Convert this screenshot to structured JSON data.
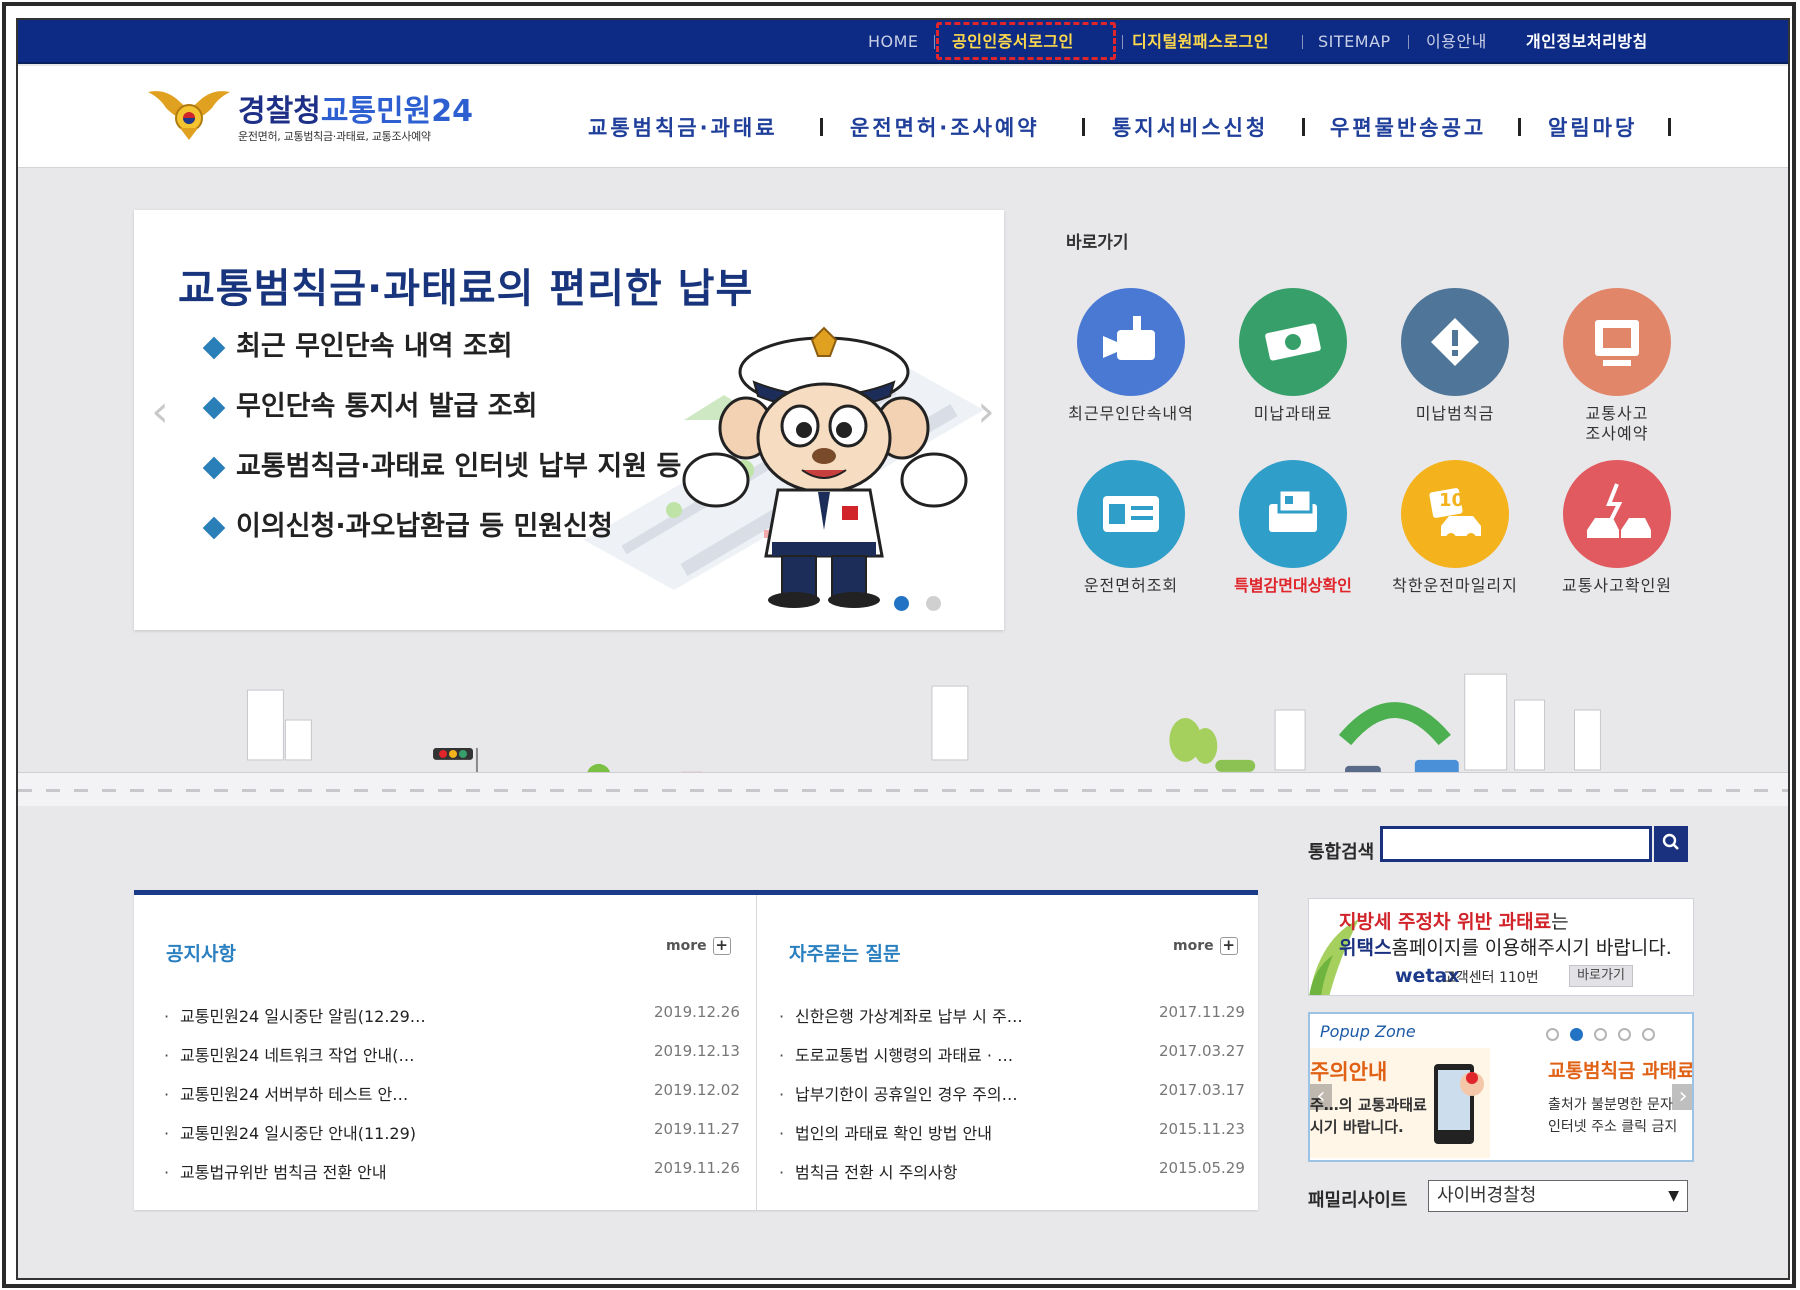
{
  "utility_nav": {
    "home": "HOME",
    "cert_login": "공인인증서로그인",
    "digital_pass_login": "디지털원패스로그인",
    "sitemap": "SITEMAP",
    "usage_guide": "이용안내",
    "privacy_policy": "개인정보처리방침"
  },
  "logo": {
    "org": "경찰청",
    "service": "교통민원24",
    "subtitle": "운전면허, 교통범칙금·과태료, 교통조사예약"
  },
  "main_nav": [
    {
      "label": "교통범칙금·과태료"
    },
    {
      "label": "운전면허·조사예약"
    },
    {
      "label": "통지서비스신청"
    },
    {
      "label": "우편물반송공고"
    },
    {
      "label": "알림마당"
    }
  ],
  "hero": {
    "headline": "교통범칙금·과태료의 편리한 납부",
    "bullets": [
      "최근 무인단속 내역 조회",
      "무인단속 통지서 발급 조회",
      "교통범칙금·과태료 인터넷 납부 지원 등",
      "이의신청·과오납환급 등 민원신청"
    ],
    "prev_arrow": "‹",
    "next_arrow": "›"
  },
  "shortcuts": {
    "title": "바로가기",
    "items": [
      {
        "label": "최근무인단속내역",
        "color": "#4a79d4",
        "icon": "camera-icon"
      },
      {
        "label": "미납과태료",
        "color": "#37a06a",
        "icon": "money-icon"
      },
      {
        "label": "미납범칙금",
        "color": "#4f7598",
        "icon": "warning-icon"
      },
      {
        "label": "교통사고\n조사예약",
        "color": "#e2866a",
        "icon": "monitor-icon"
      },
      {
        "label": "운전면허조회",
        "color": "#2f9ec9",
        "icon": "license-card-icon"
      },
      {
        "label": "특별감면대상확인",
        "color": "#2f9ec9",
        "icon": "document-icon",
        "highlight": true
      },
      {
        "label": "착한운전마일리지",
        "color": "#f4b21c",
        "icon": "mileage-car-icon",
        "badge": "10"
      },
      {
        "label": "교통사고확인원",
        "color": "#e05a5f",
        "icon": "car-crash-icon"
      }
    ]
  },
  "search": {
    "label": "통합검색",
    "placeholder": "",
    "button_icon": "search-icon"
  },
  "notices": {
    "title": "공지사항",
    "more": "more",
    "items": [
      {
        "title": "교통민원24 일시중단 알림(12.29…",
        "date": "2019.12.26"
      },
      {
        "title": "교통민원24 네트워크 작업 안내(…",
        "date": "2019.12.13"
      },
      {
        "title": "교통민원24 서버부하 테스트 안…",
        "date": "2019.12.02"
      },
      {
        "title": "교통민원24 일시중단 안내(11.29)",
        "date": "2019.11.27"
      },
      {
        "title": "교통법규위반 범칙금 전환 안내",
        "date": "2019.11.26"
      }
    ]
  },
  "faq": {
    "title": "자주묻는 질문",
    "more": "more",
    "items": [
      {
        "title": "신한은행 가상계좌로 납부 시 주…",
        "date": "2017.11.29"
      },
      {
        "title": "도로교통법 시행령의 과태료 · …",
        "date": "2017.03.27"
      },
      {
        "title": "납부기한이 공휴일인 경우 주의…",
        "date": "2017.03.17"
      },
      {
        "title": "법인의 과태료 확인 방법 안내",
        "date": "2015.11.23"
      },
      {
        "title": "범칙금 전환 시 주의사항",
        "date": "2015.05.29"
      }
    ]
  },
  "wetax_banner": {
    "line1_red": "지방세 주정차 위반 과태료",
    "line1_rest": "는",
    "line2_bold": "위택스",
    "line2_rest": "홈페이지를 이용해주시기 바랍니다.",
    "brand": "wetax",
    "call_center": "고객센터 110번",
    "go": "바로가기"
  },
  "popup_zone": {
    "title": "Popup Zone",
    "active_index": 1,
    "count": 5,
    "card1_title": "주의안내",
    "card1_line1": "주…의 교통과태료",
    "card1_line2": "시기 바랍니다.",
    "card2_title": "교통범칙금 과태료",
    "card2_line1": "출처가 불분명한 문자",
    "card2_line2": "인터넷 주소 클릭 금지"
  },
  "family_site": {
    "label": "패밀리사이트",
    "selected": "사이버경찰청"
  },
  "hero_slider": {
    "slide_count": 2,
    "active_index": 0
  }
}
